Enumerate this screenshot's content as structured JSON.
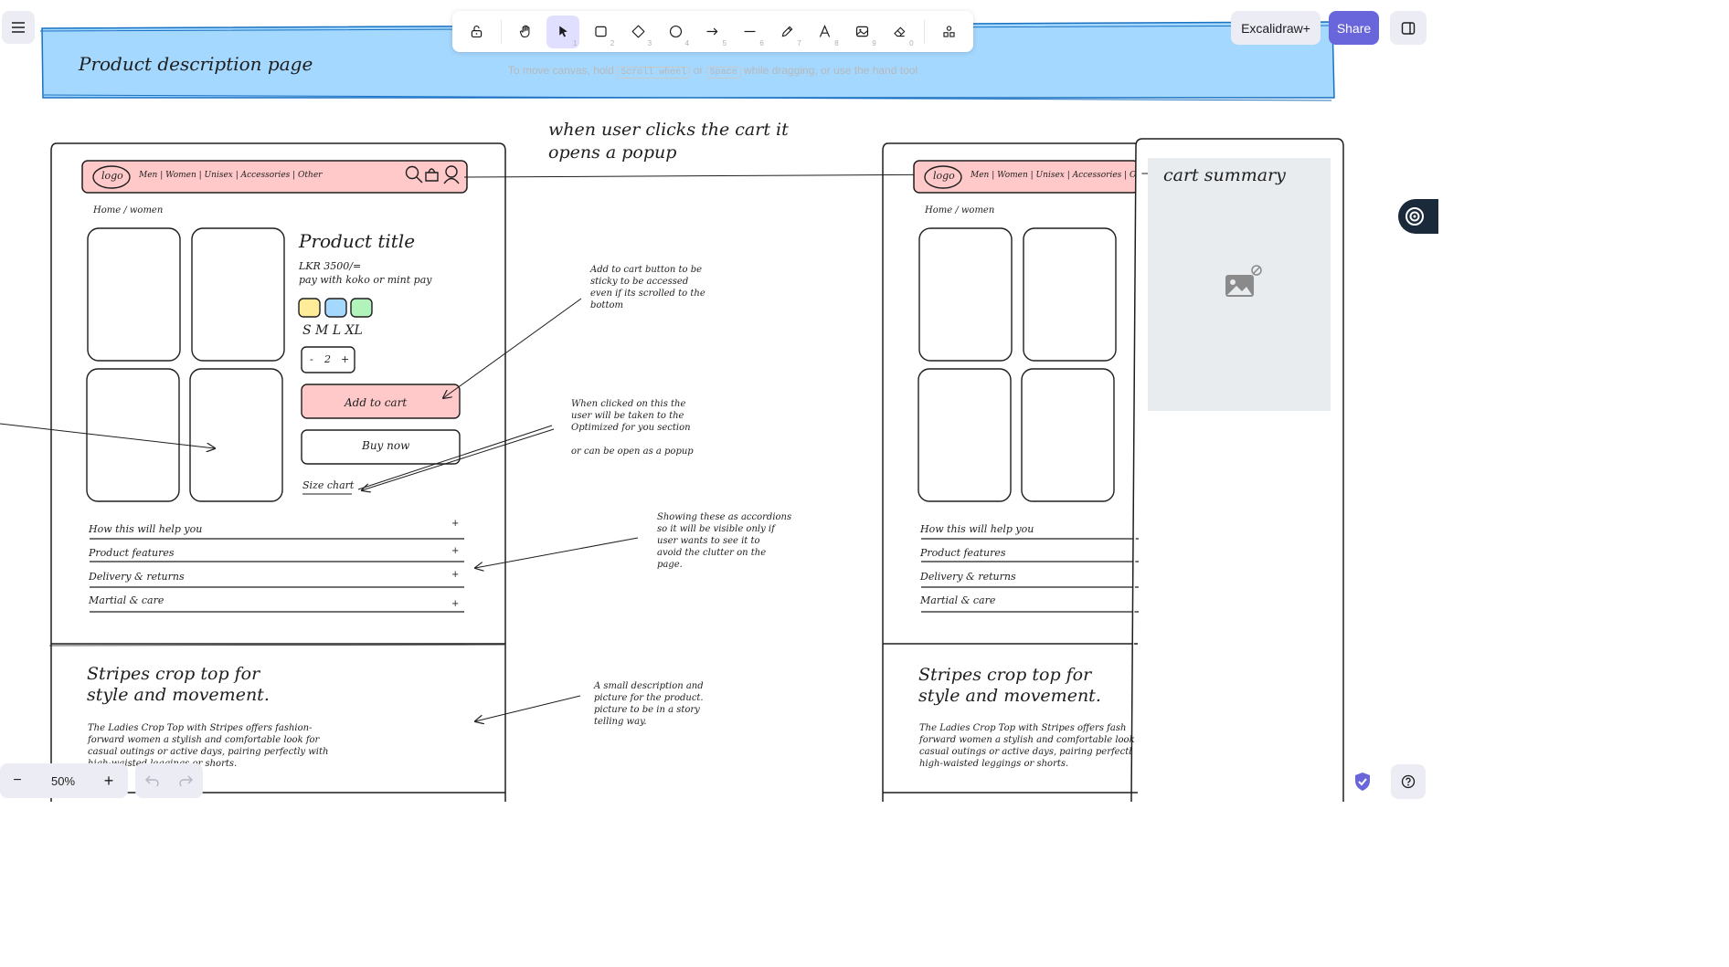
{
  "toolbar": {
    "tools": [
      {
        "name": "lock",
        "key": ""
      },
      {
        "name": "hand",
        "key": ""
      },
      {
        "name": "selection",
        "key": "1"
      },
      {
        "name": "rectangle",
        "key": "2"
      },
      {
        "name": "diamond",
        "key": "3"
      },
      {
        "name": "ellipse",
        "key": "4"
      },
      {
        "name": "arrow",
        "key": "5"
      },
      {
        "name": "line",
        "key": "6"
      },
      {
        "name": "draw",
        "key": "7"
      },
      {
        "name": "text",
        "key": "8"
      },
      {
        "name": "image",
        "key": "9"
      },
      {
        "name": "eraser",
        "key": "0"
      },
      {
        "name": "extra-tools",
        "key": ""
      }
    ]
  },
  "header": {
    "excalidraw_plus": "Excalidraw+",
    "share": "Share"
  },
  "hint": {
    "prefix": "To move canvas, hold",
    "key1": "Scroll wheel",
    "or": "or",
    "key2": "Space",
    "suffix": "while dragging, or use the hand tool"
  },
  "footer": {
    "zoom": "50%",
    "minus": "−",
    "plus": "+"
  },
  "canvas": {
    "banner_title": "Product description page",
    "cart_note": "when user clicks the cart it",
    "cart_note2": "opens a popup",
    "left": {
      "logo": "logo",
      "nav": "Men | Women | Unisex | Accessories | Other",
      "breadcrumb": "Home / women",
      "product_title": "Product title",
      "price": "LKR 3500/=",
      "pay": "pay with koko or mint pay",
      "sizes": "S  M  L  XL",
      "qty_minus": "-",
      "qty": "2",
      "qty_plus": "+",
      "add_to_cart": "Add to cart",
      "buy_now": "Buy now",
      "size_chart": "Size chart",
      "accordions": [
        "How this will help you",
        "Product features",
        "Delivery & returns",
        "Martial & care"
      ],
      "story_title1": "Stripes crop top for",
      "story_title2": "style and movement.",
      "story_lines": [
        "The Ladies Crop Top with Stripes offers fashion-",
        "forward women a stylish and comfortable look for",
        "casual outings or active days, pairing perfectly with",
        "high-waisted leggings or shorts."
      ]
    },
    "right": {
      "logo": "logo",
      "nav": "Men | Women | Unisex | Accessories | Other",
      "breadcrumb": "Home / women",
      "accordions": [
        "How this will help you",
        "Product features",
        "Delivery & returns",
        "Martial & care"
      ],
      "story_title1": "Stripes crop top for",
      "story_title2": "style and movement.",
      "story_lines": [
        "The Ladies Crop Top with Stripes offers fash",
        "forward women a stylish and comfortable look",
        "casual outings or active days, pairing perfectl",
        "high-waisted leggings or shorts."
      ],
      "cart_summary": "cart summary"
    },
    "notes": {
      "sticky": [
        "Add to cart button to be",
        "sticky to be accessed",
        "even if its scrolled to the",
        "bottom"
      ],
      "sizechart": [
        "When clicked on this the",
        "user will be taken to the",
        "Optimized for you section",
        "",
        "or can be open as a popup"
      ],
      "accordion": [
        "Showing these as accordions",
        "so it will be visible only if",
        "user wants to see it to",
        "avoid the clutter on the",
        "page."
      ],
      "story": [
        "A small description and",
        "picture for the product.",
        "picture to be in a story",
        "telling way."
      ]
    },
    "swatch_colors": [
      "#ffec99",
      "#a5d8ff",
      "#b2f2bb"
    ]
  }
}
